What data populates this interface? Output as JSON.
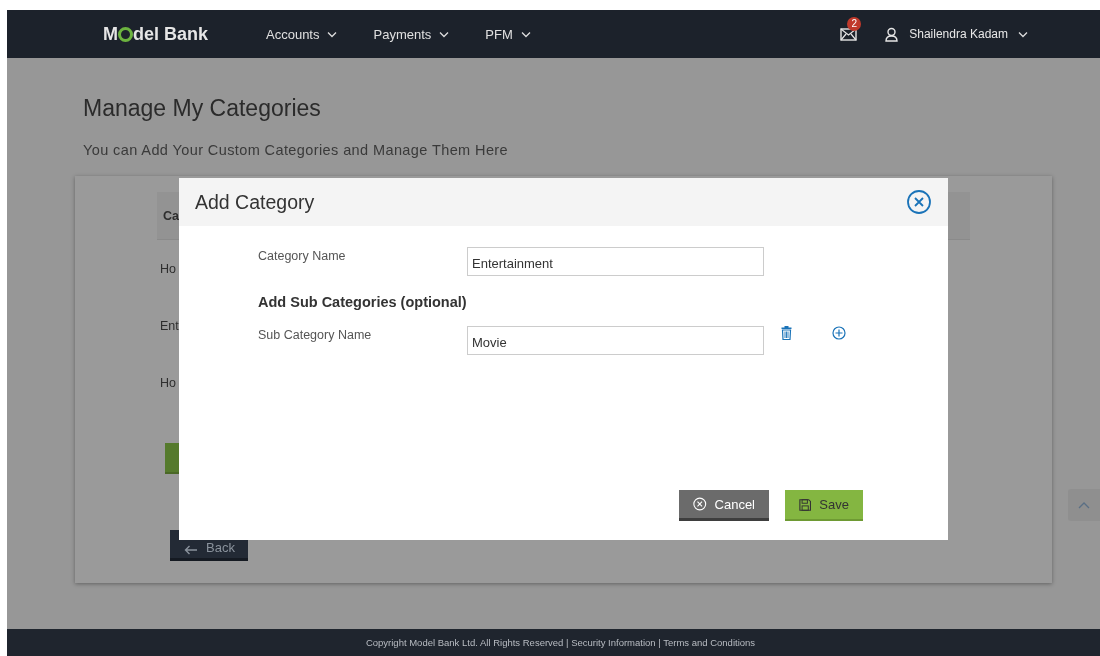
{
  "header": {
    "logo": {
      "start": "M",
      "end": "del Bank"
    },
    "nav": [
      {
        "label": "Accounts"
      },
      {
        "label": "Payments"
      },
      {
        "label": "PFM"
      }
    ],
    "mail_badge": "2",
    "user_name": "Shailendra Kadam"
  },
  "page": {
    "title": "Manage My Categories",
    "subtitle": "You can Add Your Custom Categories and Manage Them Here",
    "table": {
      "column_1": "Ca",
      "rows": [
        "Ho",
        "Ent",
        "Ho"
      ]
    },
    "back_button": "Back"
  },
  "modal": {
    "title": "Add Category",
    "fields": [
      {
        "label": "Category Name",
        "value": "Entertainment"
      }
    ],
    "section_heading": "Add Sub Categories (optional)",
    "sub_fields": [
      {
        "label": "Sub Category Name",
        "value": "Movie"
      }
    ],
    "buttons": [
      {
        "kind": "cancel",
        "label": "Cancel"
      },
      {
        "kind": "save",
        "label": "Save"
      }
    ]
  },
  "footer": {
    "copyright": "Copyright Model Bank Ltd. All Rights Reserved",
    "separator": "|",
    "links": [
      "Security Information",
      "Terms and Conditions"
    ]
  }
}
